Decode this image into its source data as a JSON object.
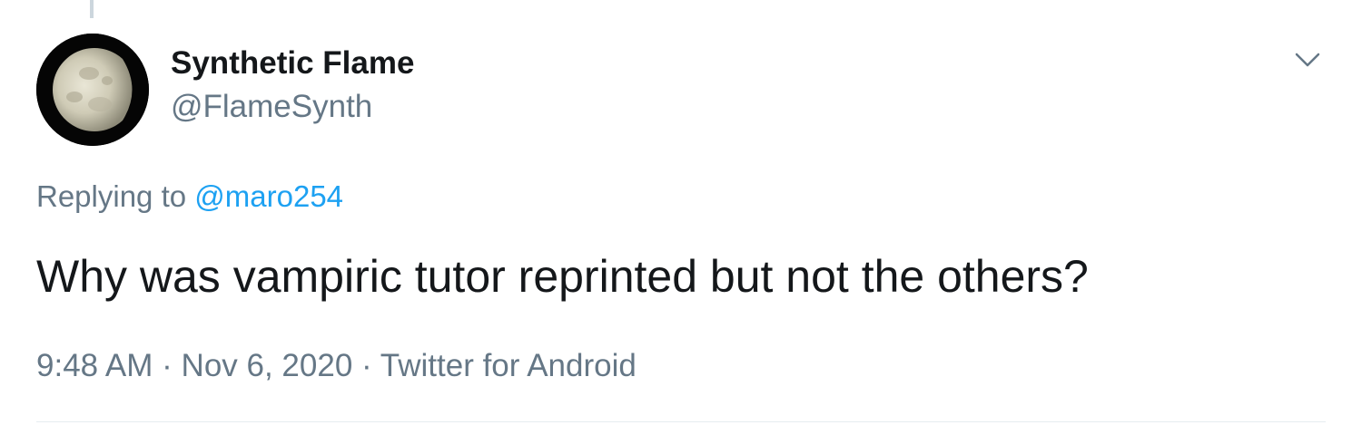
{
  "tweet": {
    "author": {
      "display_name": "Synthetic Flame",
      "handle": "@FlameSynth",
      "avatar_icon": "moon-avatar-icon"
    },
    "reply": {
      "prefix": "Replying to",
      "mention": "@maro254"
    },
    "text": "Why was vampiric tutor reprinted but not the others?",
    "meta": {
      "time": "9:48 AM",
      "separator": "·",
      "date": "Nov 6, 2020",
      "source": "Twitter for Android"
    },
    "menu_icon": "chevron-down-icon"
  },
  "colors": {
    "primary_text": "#14171a",
    "secondary_text": "#657786",
    "link": "#1da1f2",
    "divider": "#e6ecf0",
    "thread_line": "#ccd6dd"
  }
}
